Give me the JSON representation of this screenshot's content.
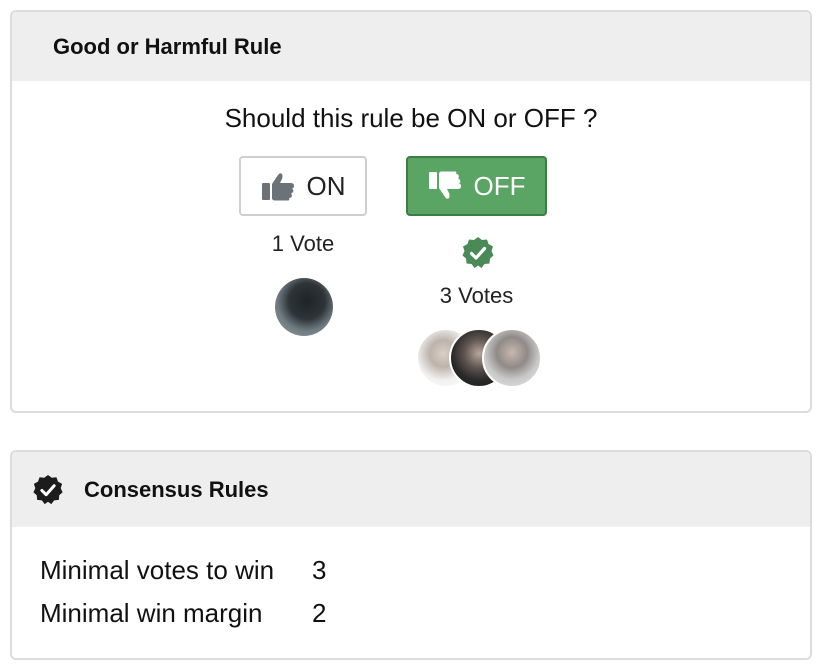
{
  "vote_card": {
    "title": "Good or Harmful Rule",
    "question": "Should this rule be ON or OFF ?",
    "on": {
      "label": "ON",
      "icon": "thumbs-up-icon",
      "count_text": "1 Vote"
    },
    "off": {
      "label": "OFF",
      "icon": "thumbs-down-icon",
      "count_text": "3 Votes",
      "selected": true,
      "badge_icon": "check-badge-icon"
    }
  },
  "consensus_card": {
    "title": "Consensus Rules",
    "icon": "check-badge-icon",
    "rules": [
      {
        "label": "Minimal votes to win",
        "value": "3"
      },
      {
        "label": "Minimal win margin",
        "value": "2"
      }
    ]
  },
  "colors": {
    "selected_button": "#5aa564",
    "badge": "#4a8a57",
    "header_bg": "#eeeeee"
  }
}
